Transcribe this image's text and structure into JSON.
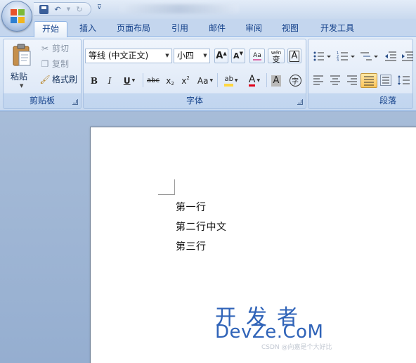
{
  "quick_access": {
    "more": "⊽"
  },
  "tabs": [
    {
      "label": "开始",
      "active": true
    },
    {
      "label": "插入"
    },
    {
      "label": "页面布局"
    },
    {
      "label": "引用"
    },
    {
      "label": "邮件"
    },
    {
      "label": "审阅"
    },
    {
      "label": "视图"
    },
    {
      "label": "开发工具"
    }
  ],
  "clipboard": {
    "group_label": "剪贴板",
    "paste": "粘贴",
    "cut": "剪切",
    "copy": "复制",
    "format_painter": "格式刷"
  },
  "font": {
    "group_label": "字体",
    "font_name": "等线 (中文正文)",
    "font_size": "小四",
    "grow": "A",
    "shrink": "A",
    "clear_format": "Aa",
    "phonetic": "wén",
    "phonetic_char": "变",
    "border_char": "A",
    "bold": "B",
    "italic": "I",
    "underline": "U",
    "strike": "abc",
    "subscript": "x",
    "superscript": "x",
    "change_case": "Aa",
    "highlight": "ab",
    "font_color": "A",
    "shading_char": "A",
    "enclose_char": "字"
  },
  "paragraph": {
    "group_label": "段落"
  },
  "document": {
    "lines": [
      "第一行",
      "第二行中文",
      "第三行"
    ]
  },
  "watermark": {
    "line1": "开发者",
    "line2": "DevZe.CoM",
    "line3": "CSDN @向嘉是个大好比"
  },
  "colors": {
    "accent": "#15428b",
    "highlight": "#ffd740",
    "font_red": "#e0001a"
  }
}
